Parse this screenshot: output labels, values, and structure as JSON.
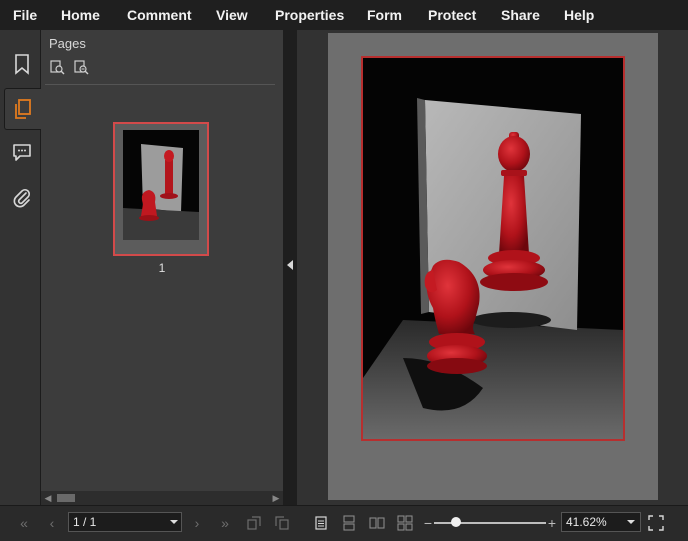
{
  "menu": {
    "items": [
      "File",
      "Home",
      "Comment",
      "View",
      "Properties",
      "Form",
      "Protect",
      "Share",
      "Help"
    ]
  },
  "rail": {
    "icons": [
      "bookmark-icon",
      "pages-icon",
      "comments-icon",
      "attachment-icon"
    ],
    "active": "pages-icon",
    "accent": "#e07a1f"
  },
  "pages_panel": {
    "title": "Pages",
    "tools": [
      "zoom-in-thumbnails-icon",
      "zoom-out-thumbnails-icon"
    ],
    "thumbnails": [
      {
        "number": "1",
        "selected": true
      }
    ],
    "selection_color": "#d24a4a"
  },
  "document": {
    "image": "red chess bishop and knight on a grey board with mirror",
    "frame_color": "#b72f2f"
  },
  "status": {
    "page_value": "1 / 1",
    "zoom_value": "41.62%",
    "zoom_level": 0.2
  }
}
